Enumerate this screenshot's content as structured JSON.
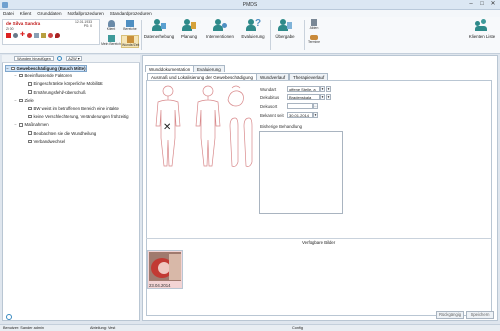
{
  "window": {
    "title": "PMDS",
    "minimize": "–",
    "maximize": "□",
    "close": "✕"
  },
  "menu": [
    "Datei",
    "Klient",
    "Grunddaten",
    "Notfallprozeduren",
    "Standardprozeduren"
  ],
  "patient": {
    "name": "de Silva Sandra",
    "room": "Zi 00",
    "line1": "12.01.1933",
    "line2": "PS: 0"
  },
  "ribbon": {
    "small": [
      {
        "label": "Klient",
        "icon": "client-icon"
      },
      {
        "label": "Bereiche",
        "icon": "areas-icon"
      },
      {
        "label": "Mein Bereich",
        "icon": "my-area-icon"
      },
      {
        "label": "Wunde/Zeit",
        "icon": "wound-time-icon"
      }
    ],
    "big": [
      {
        "label": "Datenerhebung",
        "icon": "data-collection-icon"
      },
      {
        "label": "Planung",
        "icon": "planning-icon"
      },
      {
        "label": "Interventionen",
        "icon": "interventions-icon"
      },
      {
        "label": "Evaluierung",
        "icon": "evaluation-icon"
      },
      {
        "label": "Übergabe",
        "icon": "handover-icon"
      }
    ],
    "side": [
      {
        "label": "Akten",
        "icon": "files-icon"
      },
      {
        "label": "Termine",
        "icon": "appointments-icon"
      }
    ],
    "right": {
      "label": "Klienten Liste",
      "icon": "client-list-icon"
    }
  },
  "left_toolbar": {
    "add": "Wunden hinzufügen",
    "refresh": "refresh-icon",
    "azw": "AZW ▾"
  },
  "tree": [
    {
      "level": 0,
      "text": "Gewebeschädigung (Bauch Mitte)",
      "exp": "−",
      "selected": true
    },
    {
      "level": 1,
      "text": "Beeinflussende Faktoren",
      "exp": "−"
    },
    {
      "level": 2,
      "text": "Eingeschränkte körperliche Mobilität",
      "exp": ""
    },
    {
      "level": 2,
      "text": "Ernährungsfehl/-überschuß",
      "exp": ""
    },
    {
      "level": 1,
      "text": "Ziele",
      "exp": "−"
    },
    {
      "level": 2,
      "text": "BW weist im betroffenen Bereich eine intakte",
      "exp": ""
    },
    {
      "level": 2,
      "text": "keine Verschlechterung, Veränderungen frühzeitig",
      "exp": ""
    },
    {
      "level": 1,
      "text": "Maßnahmen",
      "exp": "−"
    },
    {
      "level": 2,
      "text": "Beobachten sie die Wundheilung",
      "exp": ""
    },
    {
      "level": 2,
      "text": "Verbandwechsel",
      "exp": ""
    }
  ],
  "tabs_top": [
    "Wunddokumentation",
    "Evaluierung"
  ],
  "tabs_inner": [
    "Ausmaß und Lokalisierung der Gewebeschädigung",
    "Wundverlauf",
    "Therapieverlauf"
  ],
  "form": {
    "wundart_label": "Wundart",
    "wundart_value": "offene Stelle, a",
    "dekubitus_label": "Dekubitus",
    "dekubitus_value": "Bradenskala",
    "dekusort_label": "Dekusort",
    "dekusort_value": "",
    "bekannt_label": "Bekannt seit",
    "bekannt_value": "30.01.2014",
    "bisherige_label": "Bisherige Behandlung"
  },
  "images": {
    "label": "Verfügbare Bilder",
    "date": "23.04.2014"
  },
  "marker": "✕",
  "buttons": {
    "back": "Rückgängig",
    "save": "Speichern"
  },
  "status": {
    "user": "Benutzer: Sander admin",
    "dept": "Abteilung: Vest",
    "config": "Config"
  }
}
